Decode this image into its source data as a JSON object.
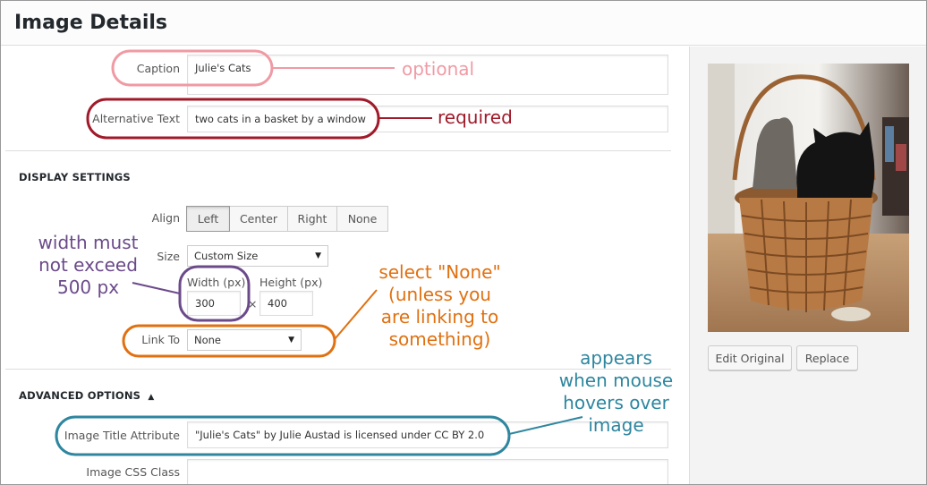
{
  "header": {
    "title": "Image Details"
  },
  "fields": {
    "caption": {
      "label": "Caption",
      "value": "Julie's Cats"
    },
    "alt_text": {
      "label": "Alternative Text",
      "value": "two cats in a basket by a window"
    }
  },
  "display_settings": {
    "heading": "DISPLAY SETTINGS",
    "align": {
      "label": "Align",
      "options": [
        "Left",
        "Center",
        "Right",
        "None"
      ],
      "selected": "Left"
    },
    "size": {
      "label": "Size",
      "value": "Custom Size"
    },
    "width": {
      "label": "Width (px)",
      "value": "300"
    },
    "times": "×",
    "height": {
      "label": "Height (px)",
      "value": "400"
    },
    "link_to": {
      "label": "Link To",
      "value": "None"
    }
  },
  "advanced_options": {
    "heading": "ADVANCED OPTIONS",
    "toggle": "▲",
    "title_attribute": {
      "label": "Image Title Attribute",
      "value": "\"Julie's Cats\" by Julie Austad is licensed under CC BY 2.0"
    },
    "css_class": {
      "label": "Image CSS Class",
      "value": ""
    }
  },
  "sidebar": {
    "edit_original": "Edit Original",
    "replace": "Replace"
  },
  "annotations": {
    "optional": "optional",
    "required": "required",
    "width_note": [
      "width must",
      "not exceed",
      "500 px"
    ],
    "link_note": [
      "select \"None\"",
      "(unless you",
      "are linking to",
      "something)"
    ],
    "hover_note": [
      "appears",
      "when mouse",
      "hovers over",
      "image"
    ]
  },
  "colors": {
    "optional": "#f09aa4",
    "required": "#a01a2a",
    "width_note": "#6b4a8a",
    "link_note": "#e07010",
    "hover_note": "#2e869f"
  }
}
